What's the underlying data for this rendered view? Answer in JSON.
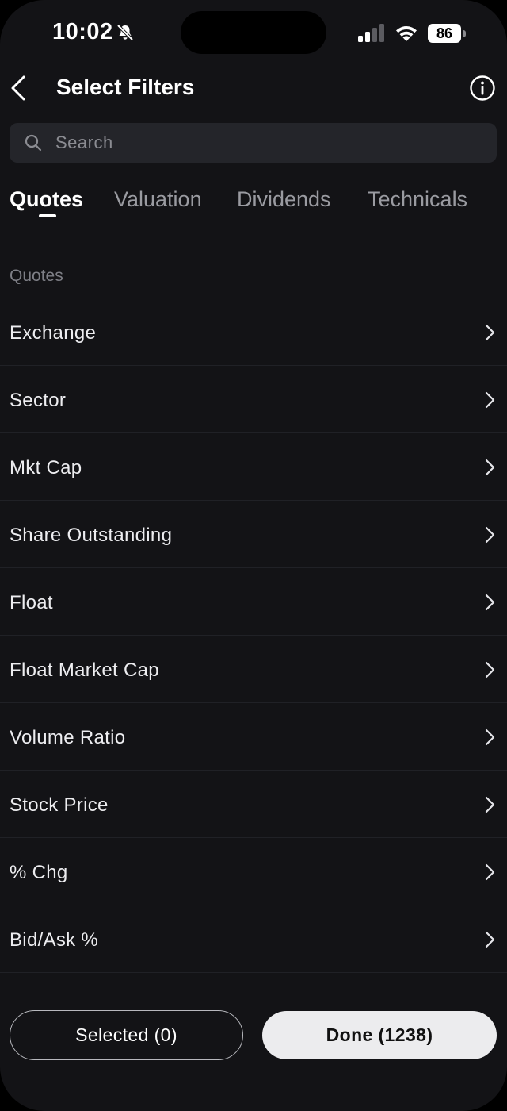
{
  "status_bar": {
    "time": "10:02",
    "battery": "86",
    "icons": [
      "bell-muted-icon",
      "cellular-signal-icon",
      "wifi-icon",
      "battery-icon"
    ]
  },
  "header": {
    "title": "Select Filters",
    "icons": [
      "back-chevron-icon",
      "info-icon"
    ]
  },
  "search": {
    "placeholder": "Search",
    "value": "",
    "icon": "search-icon"
  },
  "tabs": [
    {
      "label": "Quotes",
      "active": true
    },
    {
      "label": "Valuation",
      "active": false
    },
    {
      "label": "Dividends",
      "active": false
    },
    {
      "label": "Technicals",
      "active": false
    }
  ],
  "section": {
    "label": "Quotes",
    "items": [
      {
        "label": "Exchange"
      },
      {
        "label": "Sector"
      },
      {
        "label": "Mkt Cap"
      },
      {
        "label": "Share Outstanding"
      },
      {
        "label": "Float"
      },
      {
        "label": "Float Market Cap"
      },
      {
        "label": "Volume Ratio"
      },
      {
        "label": "Stock Price"
      },
      {
        "label": "% Chg"
      },
      {
        "label": "Bid/Ask %"
      }
    ]
  },
  "footer": {
    "selected_label": "Selected (0)",
    "done_label": "Done (1238)"
  },
  "colors": {
    "background": "#131316",
    "search_bg": "#24252a",
    "muted_text": "#9a9ba1",
    "done_button_bg": "#ececee"
  }
}
